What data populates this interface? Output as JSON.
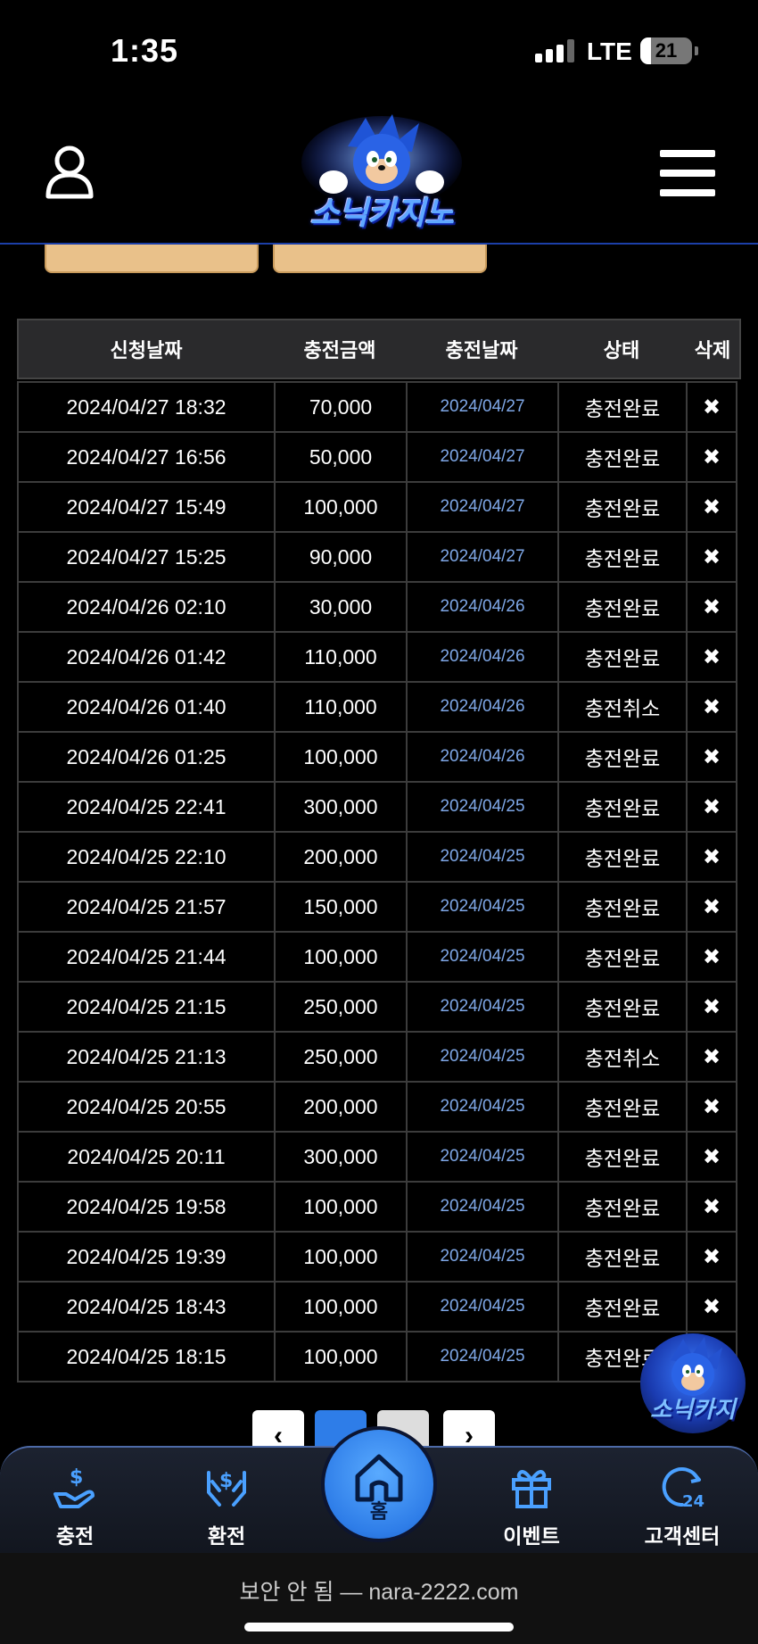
{
  "status_bar": {
    "time": "1:35",
    "network": "LTE",
    "battery": "21",
    "battery_level": 0.21
  },
  "header": {
    "logo_text": "소닉카지노",
    "icons": [
      "user-icon",
      "menu-icon"
    ]
  },
  "table": {
    "headers": [
      "신청날짜",
      "충전금액",
      "충전날짜",
      "상태",
      "삭제"
    ],
    "rows": [
      [
        "2024/04/27 18:32",
        "70,000",
        "2024/04/27",
        "충전완료"
      ],
      [
        "2024/04/27 16:56",
        "50,000",
        "2024/04/27",
        "충전완료"
      ],
      [
        "2024/04/27 15:49",
        "100,000",
        "2024/04/27",
        "충전완료"
      ],
      [
        "2024/04/27 15:25",
        "90,000",
        "2024/04/27",
        "충전완료"
      ],
      [
        "2024/04/26 02:10",
        "30,000",
        "2024/04/26",
        "충전완료"
      ],
      [
        "2024/04/26 01:42",
        "110,000",
        "2024/04/26",
        "충전완료"
      ],
      [
        "2024/04/26 01:40",
        "110,000",
        "2024/04/26",
        "충전취소"
      ],
      [
        "2024/04/26 01:25",
        "100,000",
        "2024/04/26",
        "충전완료"
      ],
      [
        "2024/04/25 22:41",
        "300,000",
        "2024/04/25",
        "충전완료"
      ],
      [
        "2024/04/25 22:10",
        "200,000",
        "2024/04/25",
        "충전완료"
      ],
      [
        "2024/04/25 21:57",
        "150,000",
        "2024/04/25",
        "충전완료"
      ],
      [
        "2024/04/25 21:44",
        "100,000",
        "2024/04/25",
        "충전완료"
      ],
      [
        "2024/04/25 21:15",
        "250,000",
        "2024/04/25",
        "충전완료"
      ],
      [
        "2024/04/25 21:13",
        "250,000",
        "2024/04/25",
        "충전취소"
      ],
      [
        "2024/04/25 20:55",
        "200,000",
        "2024/04/25",
        "충전완료"
      ],
      [
        "2024/04/25 20:11",
        "300,000",
        "2024/04/25",
        "충전완료"
      ],
      [
        "2024/04/25 19:58",
        "100,000",
        "2024/04/25",
        "충전완료"
      ],
      [
        "2024/04/25 19:39",
        "100,000",
        "2024/04/25",
        "충전완료"
      ],
      [
        "2024/04/25 18:43",
        "100,000",
        "2024/04/25",
        "충전완료"
      ],
      [
        "2024/04/25 18:15",
        "100,000",
        "2024/04/25",
        "충전완료"
      ]
    ],
    "delete_glyph": "✖"
  },
  "pagination": {
    "prev": "‹",
    "next": "›"
  },
  "floating_mascot": {
    "text": "소닉카지"
  },
  "bottom_nav": {
    "items": [
      {
        "label": "충전",
        "icon": "deposit-icon"
      },
      {
        "label": "환전",
        "icon": "withdraw-icon"
      },
      {
        "label": "홈",
        "icon": "home-icon"
      },
      {
        "label": "이벤트",
        "icon": "gift-icon"
      },
      {
        "label": "고객센터",
        "icon": "support-24-icon"
      }
    ]
  },
  "browser": {
    "url_text": "보안 안 됨 — nara-2222.com"
  },
  "colors": {
    "accent": "#2e7de8",
    "header_border": "#1c3fa8",
    "date_blue": "#7fa8e8",
    "peek_button": "#e9c18a"
  }
}
